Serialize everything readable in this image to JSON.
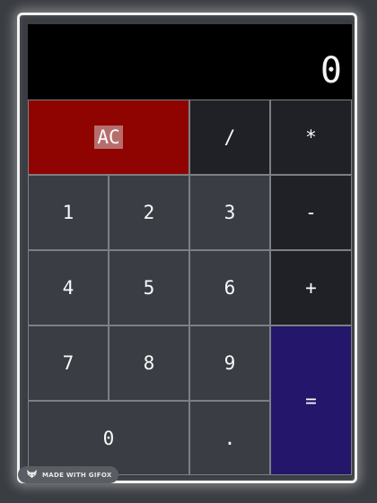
{
  "display": {
    "value": "0"
  },
  "keys": {
    "ac": "AC",
    "divide": "/",
    "multiply": "*",
    "one": "1",
    "two": "2",
    "three": "3",
    "minus": "-",
    "four": "4",
    "five": "5",
    "six": "6",
    "plus": "+",
    "seven": "7",
    "eight": "8",
    "nine": "9",
    "equals": "=",
    "zero": "0",
    "decimal": "."
  },
  "badge": {
    "label": "MADE WITH GIFOX",
    "icon": "fox-icon"
  },
  "colors": {
    "ac": "#8f0400",
    "operator": "#1f2127",
    "digit": "#3a3d44",
    "equals": "#23166b",
    "display": "#000000"
  }
}
